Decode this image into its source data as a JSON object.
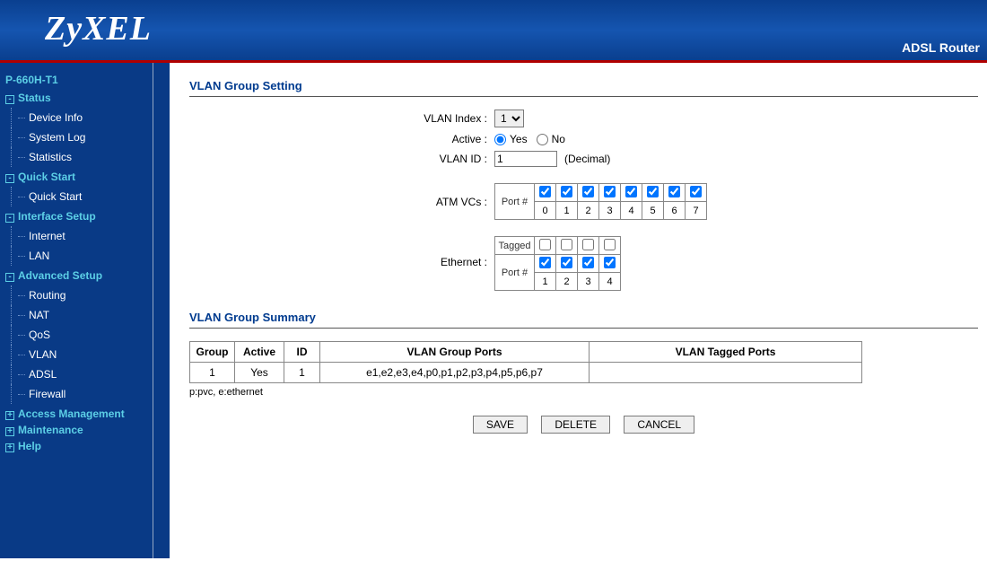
{
  "brand": "ZyXEL",
  "router_label": "ADSL Router",
  "model": "P-660H-T1",
  "nav": [
    {
      "title": "Status",
      "expanded": true,
      "items": [
        "Device Info",
        "System Log",
        "Statistics"
      ]
    },
    {
      "title": "Quick Start",
      "expanded": true,
      "items": [
        "Quick Start"
      ]
    },
    {
      "title": "Interface Setup",
      "expanded": true,
      "items": [
        "Internet",
        "LAN"
      ]
    },
    {
      "title": "Advanced Setup",
      "expanded": true,
      "items": [
        "Routing",
        "NAT",
        "QoS",
        "VLAN",
        "ADSL",
        "Firewall"
      ]
    },
    {
      "title": "Access Management",
      "expanded": false,
      "items": []
    },
    {
      "title": "Maintenance",
      "expanded": false,
      "items": []
    },
    {
      "title": "Help",
      "expanded": false,
      "items": []
    }
  ],
  "section1_title": "VLAN Group Setting",
  "section2_title": "VLAN Group Summary",
  "labels": {
    "vlan_index": "VLAN Index :",
    "active": "Active :",
    "vlan_id": "VLAN ID :",
    "decimal": "(Decimal)",
    "atm_vcs": "ATM VCs :",
    "port_num": "Port #",
    "tagged": "Tagged",
    "ethernet": "Ethernet :",
    "yes": "Yes",
    "no": "No"
  },
  "form": {
    "vlan_index_value": "1",
    "vlan_index_options": [
      "1"
    ],
    "active": "Yes",
    "vlan_id": "1",
    "atm_ports": [
      "0",
      "1",
      "2",
      "3",
      "4",
      "5",
      "6",
      "7"
    ],
    "atm_checked": [
      true,
      true,
      true,
      true,
      true,
      true,
      true,
      true
    ],
    "eth_ports": [
      "1",
      "2",
      "3",
      "4"
    ],
    "eth_tagged": [
      false,
      false,
      false,
      false
    ],
    "eth_port_checked": [
      true,
      true,
      true,
      true
    ]
  },
  "summary": {
    "headers": [
      "Group",
      "Active",
      "ID",
      "VLAN Group Ports",
      "VLAN Tagged Ports"
    ],
    "rows": [
      {
        "group": "1",
        "active": "Yes",
        "id": "1",
        "ports": "e1,e2,e3,e4,p0,p1,p2,p3,p4,p5,p6,p7",
        "tagged": ""
      }
    ],
    "legend": "p:pvc, e:ethernet"
  },
  "buttons": {
    "save": "SAVE",
    "delete": "DELETE",
    "cancel": "CANCEL"
  }
}
